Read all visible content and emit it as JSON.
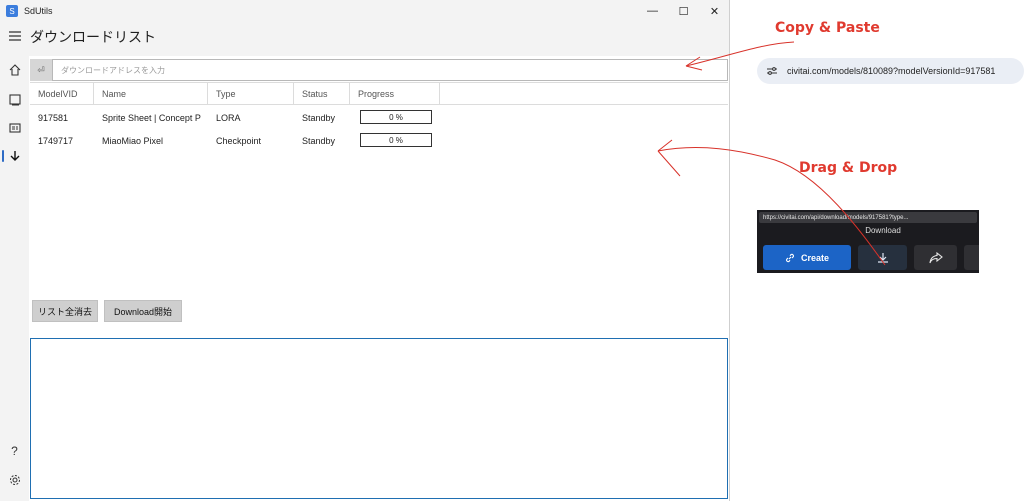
{
  "window": {
    "app_title": "SdUtils",
    "controls": {
      "minimize": "—",
      "maximize": "☐",
      "close": "✕"
    }
  },
  "sidebar": {
    "items": [
      {
        "icon": "hamburger-menu-icon"
      },
      {
        "icon": "home-icon"
      },
      {
        "icon": "image-icon"
      },
      {
        "icon": "gallery-icon"
      },
      {
        "icon": "download-arrow-icon",
        "active": true
      },
      {
        "icon": "help-icon",
        "glyph": "?"
      },
      {
        "icon": "settings-icon"
      }
    ]
  },
  "page": {
    "title": "ダウンロードリスト"
  },
  "url_input": {
    "placeholder": "ダウンロードアドレスを入力",
    "button_glyph": "⏎"
  },
  "grid": {
    "headers": [
      "ModelVID",
      "Name",
      "Type",
      "Status",
      "Progress"
    ],
    "rows": [
      {
        "model_vid": "917581",
        "name": "Sprite Sheet | Concept P",
        "type": "LORA",
        "status": "Standby",
        "progress": "0 %"
      },
      {
        "model_vid": "1749717",
        "name": "MiaoMiao Pixel",
        "type": "Checkpoint",
        "status": "Standby",
        "progress": "0 %"
      }
    ]
  },
  "buttons": {
    "clear_list": "リスト全消去",
    "start_download": "Download開始"
  },
  "annotations": {
    "copy_paste": "Copy & Paste",
    "drag_drop": "Drag & Drop",
    "accent_color": "#e03a2f"
  },
  "browser_url": {
    "text": "civitai.com/models/810089?modelVersionId=917581"
  },
  "browser_panel": {
    "link_url": "https://civitai.com/api/download/models/917581?type...",
    "tooltip": "Download",
    "create_label": "Create"
  }
}
